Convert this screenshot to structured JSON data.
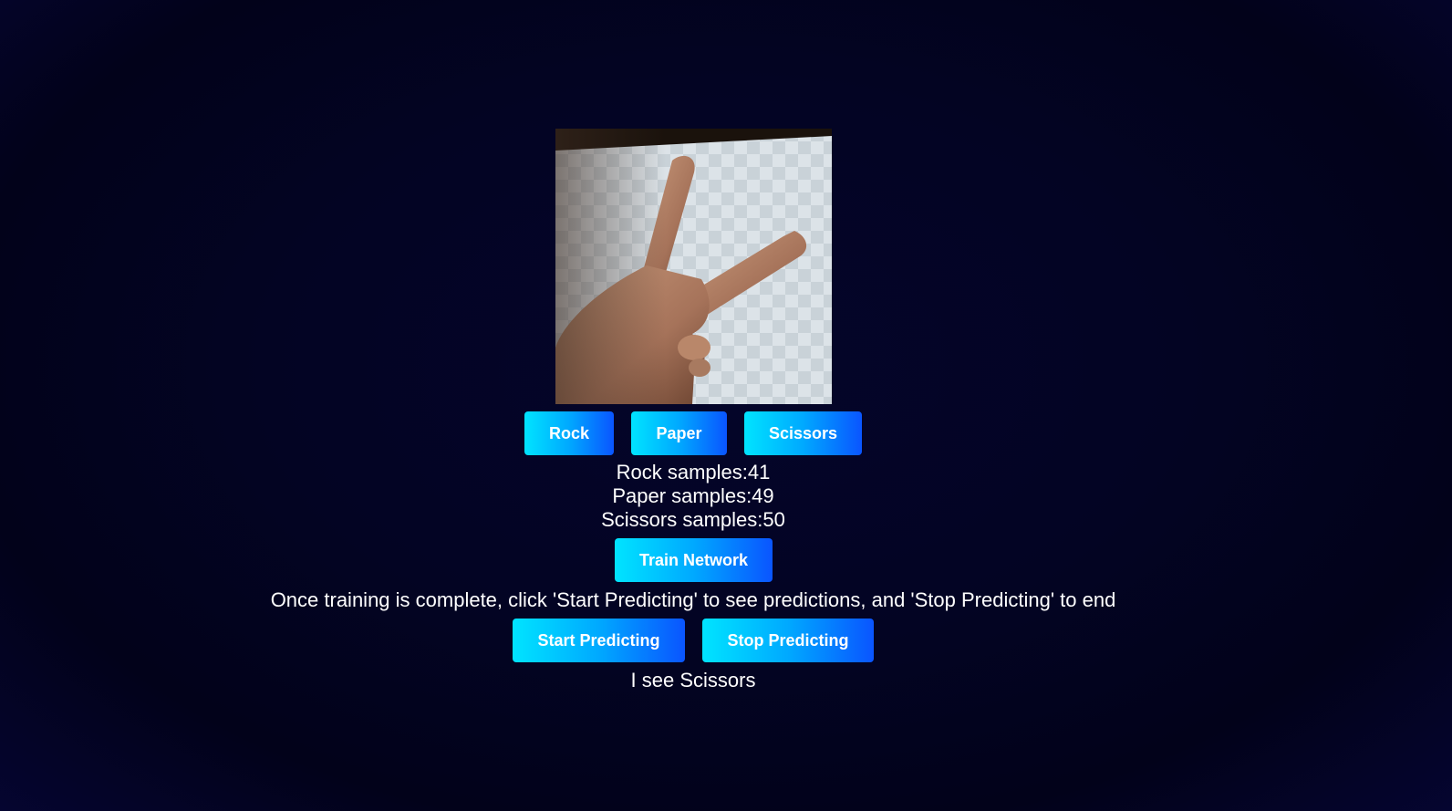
{
  "webcam": {
    "icon": "webcam-feed-hand-scissors"
  },
  "buttons": {
    "rock": "Rock",
    "paper": "Paper",
    "scissors": "Scissors",
    "train": "Train Network",
    "start": "Start Predicting",
    "stop": "Stop Predicting"
  },
  "samples": {
    "rock": "Rock samples:41",
    "paper": "Paper samples:49",
    "scissors": "Scissors samples:50"
  },
  "instructions": "Once training is complete, click 'Start Predicting' to see predictions, and 'Stop Predicting' to end",
  "prediction": "I see Scissors",
  "colors": {
    "background": "#03031f",
    "button_gradient_start": "#00e4ff",
    "button_gradient_end": "#0a55ff",
    "text": "#ffffff"
  }
}
